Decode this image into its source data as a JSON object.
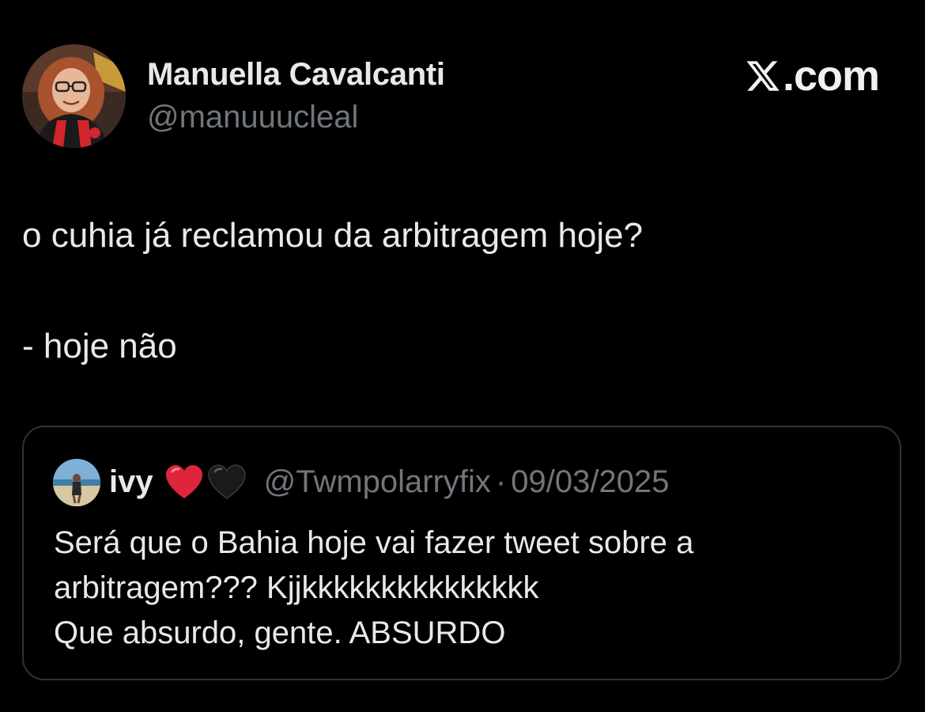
{
  "author": {
    "display_name": "Manuella Cavalcanti",
    "handle": "@manuuucleal",
    "avatar_icon": "profile-photo"
  },
  "brand": {
    "logo_icon": "x-logo-icon",
    "text": ".com"
  },
  "tweet": {
    "line1": "o cuhia já reclamou da arbitragem hoje?",
    "line2": "- hoje não"
  },
  "quote": {
    "display_name": "ivy",
    "emojis": [
      "red-heart-icon",
      "black-heart-icon"
    ],
    "handle": "@Twmpolarryfix",
    "separator": "·",
    "date": "09/03/2025",
    "lines": [
      "Será que o Bahia hoje vai fazer tweet sobre a",
      "arbitragem??? Kjjkkkkkkkkkkkkkkk",
      "Que absurdo, gente. ABSURDO"
    ]
  },
  "colors": {
    "background": "#000000",
    "primary_text": "#e7e9ea",
    "secondary_text": "#71767b",
    "border": "#2f3336",
    "heart_red": "#e0243c",
    "heart_black": "#1a1a1a"
  }
}
